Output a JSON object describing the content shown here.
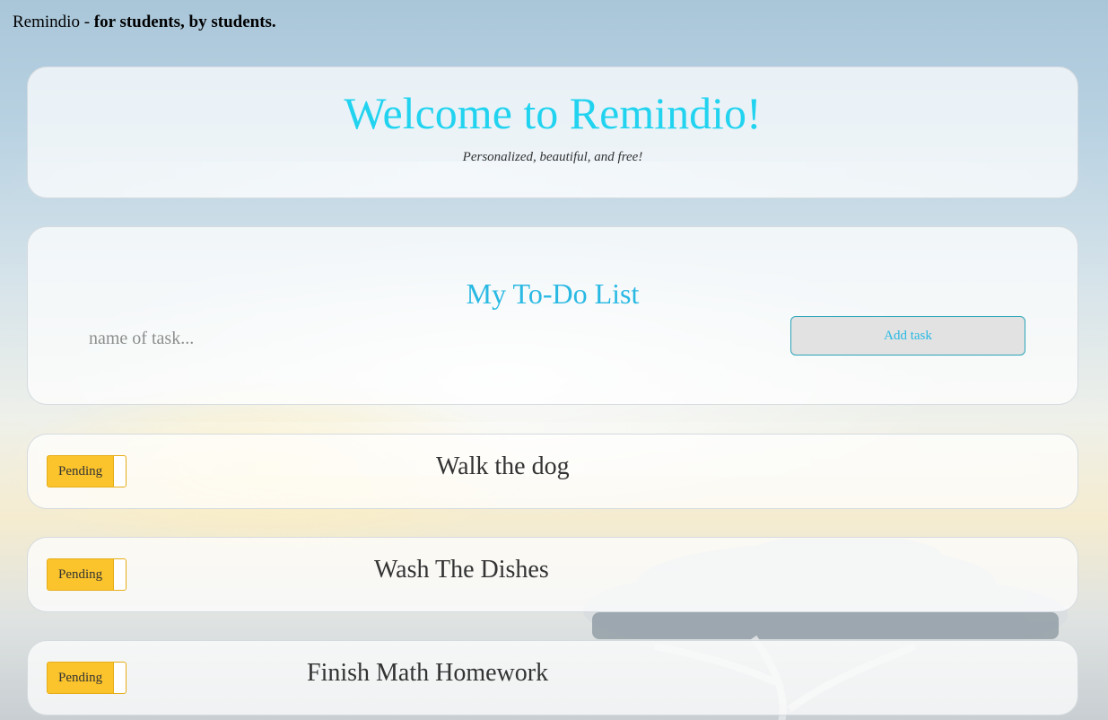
{
  "topbar": {
    "brand": "Remindio - ",
    "tagline": "for students, by students."
  },
  "welcome": {
    "title": "Welcome to Remindio!",
    "subtitle": "Personalized, beautiful, and free!"
  },
  "todo": {
    "title": "My To-Do List",
    "input_placeholder": "name of task...",
    "input_value": "",
    "add_button_label": "Add task"
  },
  "tasks": [
    {
      "name": "Walk the dog",
      "status": "Pending"
    },
    {
      "name": "Wash The Dishes",
      "status": "Pending"
    },
    {
      "name": "Finish Math Homework",
      "status": "Pending"
    }
  ],
  "colors": {
    "accent": "#22d3f0",
    "heading": "#2ab9e3",
    "pending": "#fbc42c"
  }
}
